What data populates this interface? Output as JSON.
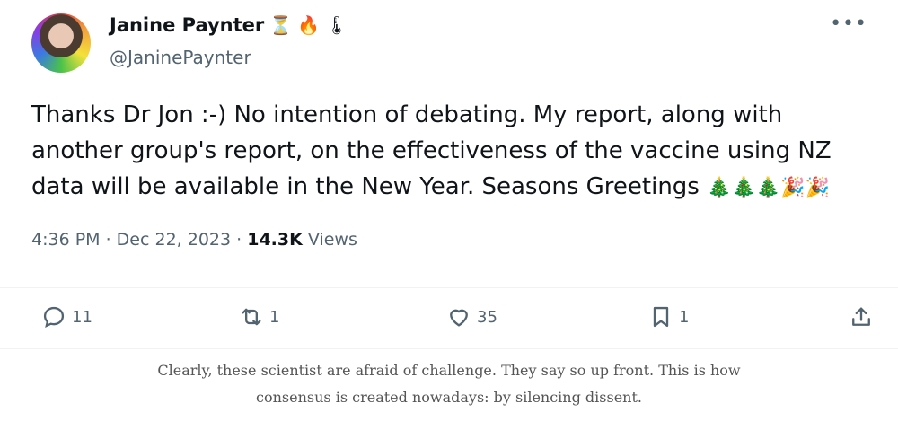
{
  "author": {
    "name": "Janine Paynter",
    "handle": "@JaninePaynter",
    "badges": [
      "⏳",
      "🔥",
      "🌡"
    ]
  },
  "tweet": {
    "text": "Thanks Dr Jon :-) No intention of debating. My report, along with another group's report, on the effectiveness of the vaccine using NZ data will be available in the New Year.  Seasons Greetings ",
    "emoji": "🎄🎄🎄🎉🎉",
    "time": "4:36 PM · Dec 22, 2023 · ",
    "views_count": "14.3K",
    "views_label": " Views"
  },
  "actions": {
    "replies": "11",
    "retweets": "1",
    "likes": "35",
    "bookmarks": "1"
  },
  "menu_glyph": "•••",
  "caption": {
    "line1": "Clearly, these scientist are afraid of challenge. They say so up front. This is how",
    "line2": "consensus is created nowadays: by silencing dissent."
  }
}
